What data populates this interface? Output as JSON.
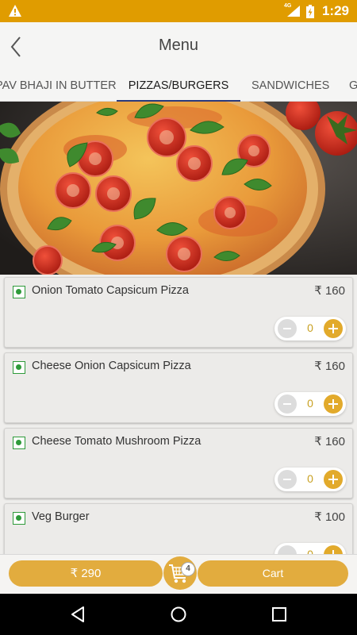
{
  "status_bar": {
    "network_label": "4G",
    "time": "1:29"
  },
  "header": {
    "title": "Menu"
  },
  "tabs": [
    {
      "label": "PAV BHAJI IN BUTTER",
      "active": false
    },
    {
      "label": "PIZZAS/BURGERS",
      "active": true
    },
    {
      "label": "SANDWICHES",
      "active": false
    },
    {
      "label": "G",
      "active": false
    }
  ],
  "items": [
    {
      "name": "Onion Tomato Capsicum Pizza",
      "price": "₹ 160",
      "qty": "0"
    },
    {
      "name": "Cheese Onion Capsicum Pizza",
      "price": "₹ 160",
      "qty": "0"
    },
    {
      "name": "Cheese Tomato Mushroom Pizza",
      "price": "₹ 160",
      "qty": "0"
    },
    {
      "name": "Veg Burger",
      "price": "₹ 100",
      "qty": "0"
    }
  ],
  "cart": {
    "total": "₹ 290",
    "count": "4",
    "button_label": "Cart"
  },
  "colors": {
    "status_bar": "#e09c00",
    "accent": "#e2ac3e",
    "tab_indicator": "#2a3a7c",
    "veg_green": "#2e9a3a"
  },
  "icons": {
    "status_left": "warning-icon",
    "header_left": "back-arrow-icon",
    "veg": "veg-indicator-icon",
    "cart": "cart-icon",
    "nav": [
      "nav-back-icon",
      "nav-home-icon",
      "nav-recents-icon"
    ]
  }
}
